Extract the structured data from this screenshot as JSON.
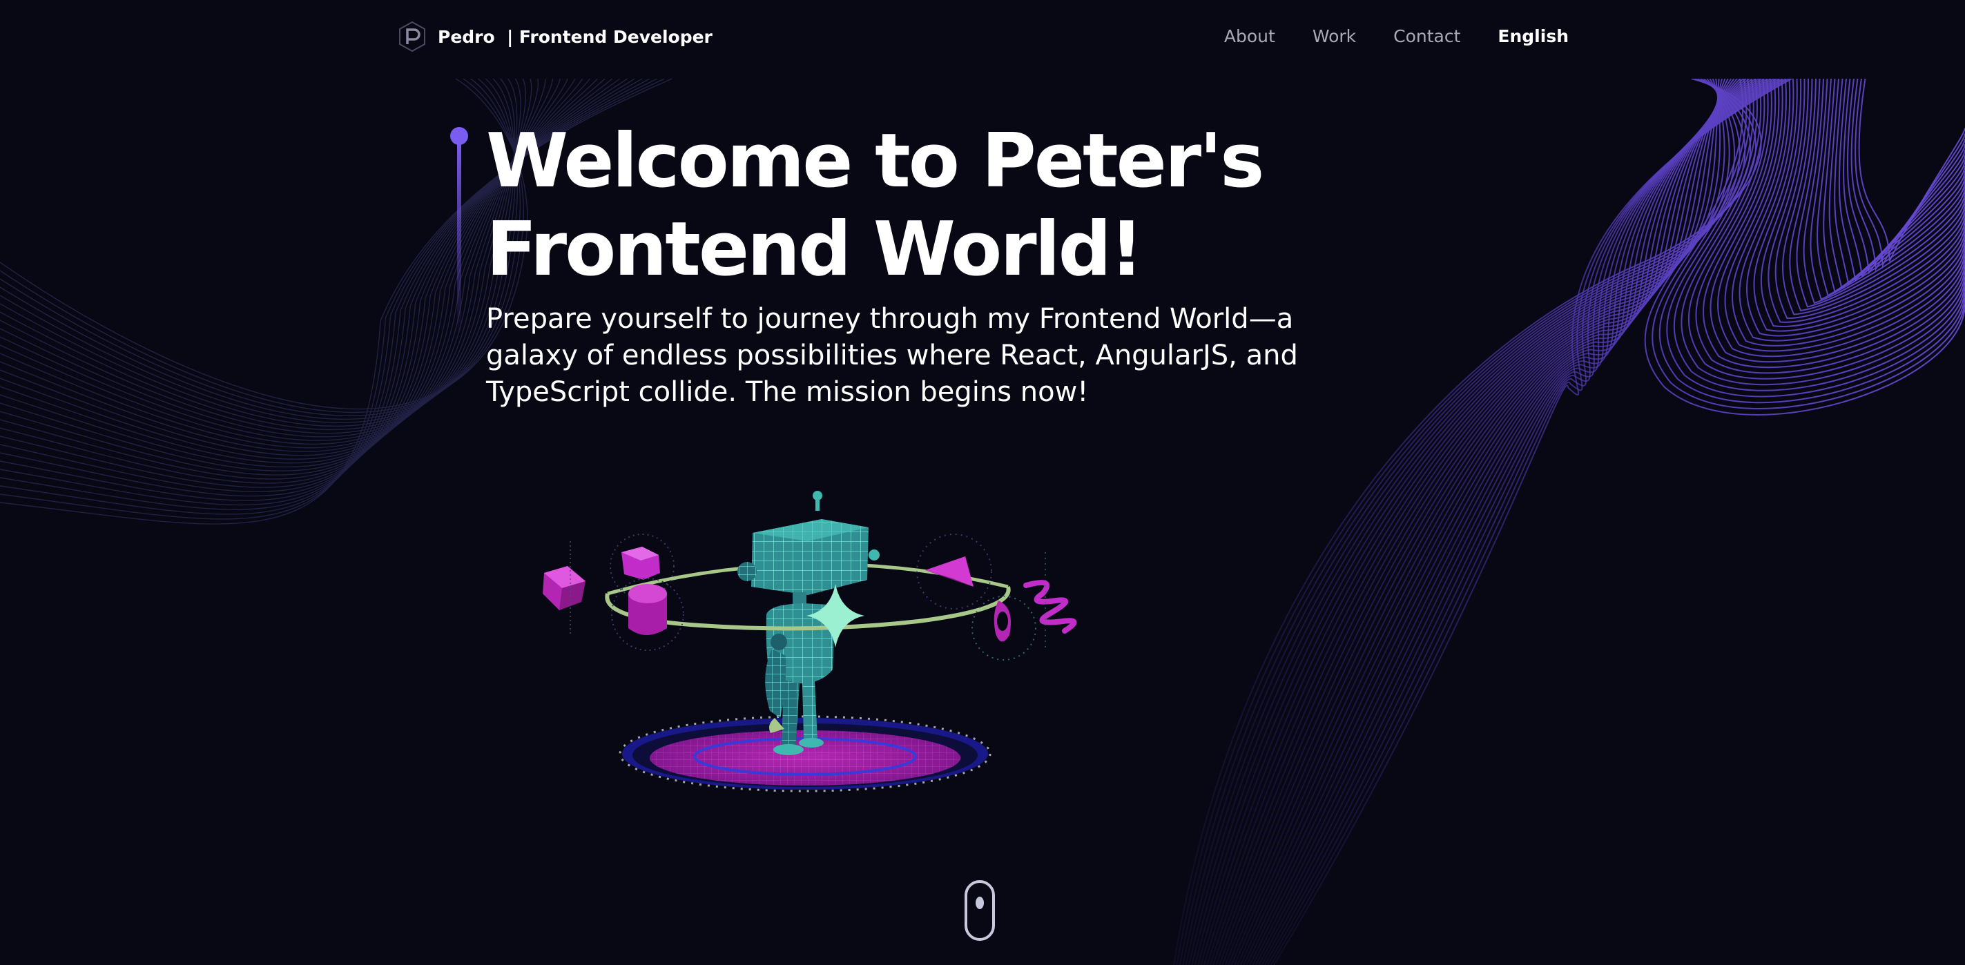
{
  "navbar": {
    "brand": {
      "name": "Pedro",
      "separator": "|",
      "role": "Frontend Developer",
      "full": "Pedro  | Frontend Developer"
    },
    "links": [
      {
        "label": "About"
      },
      {
        "label": "Work"
      },
      {
        "label": "Contact"
      }
    ],
    "language": "English"
  },
  "hero": {
    "title_line1": "Welcome to Peter's",
    "title_line2": "Frontend World!",
    "subtitle_line1": "Prepare yourself to journey through my Frontend World—a",
    "subtitle_line2": "galaxy of endless possibilities where React, AngularJS, and",
    "subtitle_line3": "TypeScript collide. The mission begins now!"
  },
  "colors": {
    "background": "#080814",
    "accent_purple": "#7b5cf0",
    "wave_purple": "#5a3fc0",
    "robot_cyan": "#3fb8b0",
    "magenta": "#c22cc9",
    "nav_muted": "#a9a9b8"
  },
  "icons": {
    "logo": "p-hexagon-logo-icon",
    "scroll": "mouse-scroll-icon"
  }
}
